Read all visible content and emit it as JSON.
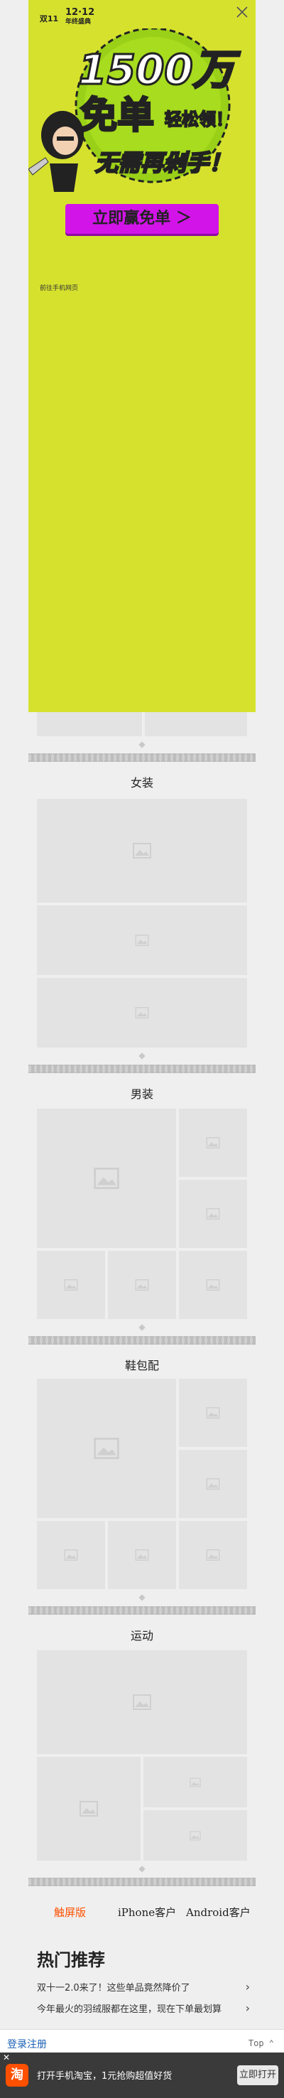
{
  "sections": [
    {
      "title": "女装"
    },
    {
      "title": "男装"
    },
    {
      "title": "鞋包配"
    },
    {
      "title": "运动"
    }
  ],
  "footer_links": {
    "touch": "触屏版",
    "iphone": "iPhone客户",
    "android": "Android客户"
  },
  "hot": {
    "title": "热门推荐",
    "items": [
      "双十一2.0来了！这些单品竟然降价了",
      "今年最火的羽绒服都在这里，现在下单最划算"
    ]
  },
  "bottom_bar": {
    "link1": "登录",
    "link2": "注册",
    "top": "Top ⌃"
  },
  "app_banner": {
    "logo": "淘",
    "text": "打开手机淘宝，1元抢购超值好货",
    "open": "立即打开"
  },
  "overlay": {
    "brand_mark": "双11",
    "date": "12·12",
    "event": "年终盛典",
    "headline": "1500万",
    "free": "免单",
    "easy": "轻松领！",
    "no_need": "无需再剁手！",
    "cta": "立即赢免单 ＞",
    "go_mobile": "前往手机网页"
  },
  "colors": {
    "overlay_bg": "#d6e12e",
    "cta_bg": "#d214e8",
    "page_bg": "#efefef",
    "footer_accent": "#ff5000"
  }
}
